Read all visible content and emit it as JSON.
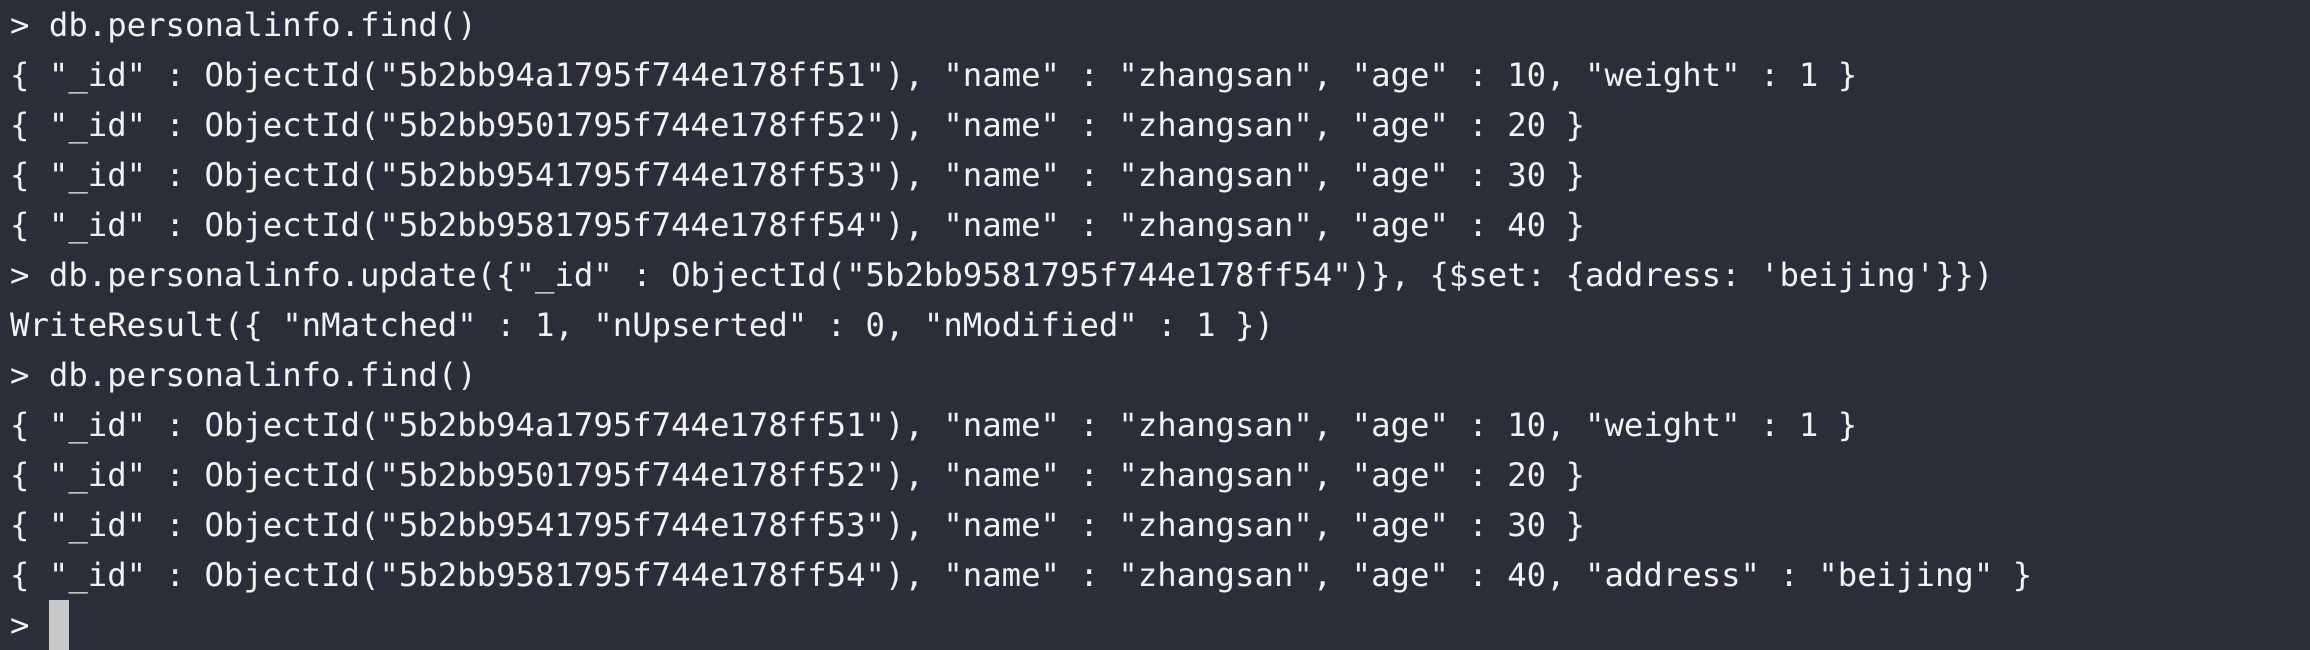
{
  "terminal": {
    "prompt": "> ",
    "lines": [
      {
        "prompt": "> ",
        "text": "db.personalinfo.find()"
      },
      {
        "prompt": "",
        "text": "{ \"_id\" : ObjectId(\"5b2bb94a1795f744e178ff51\"), \"name\" : \"zhangsan\", \"age\" : 10, \"weight\" : 1 }"
      },
      {
        "prompt": "",
        "text": "{ \"_id\" : ObjectId(\"5b2bb9501795f744e178ff52\"), \"name\" : \"zhangsan\", \"age\" : 20 }"
      },
      {
        "prompt": "",
        "text": "{ \"_id\" : ObjectId(\"5b2bb9541795f744e178ff53\"), \"name\" : \"zhangsan\", \"age\" : 30 }"
      },
      {
        "prompt": "",
        "text": "{ \"_id\" : ObjectId(\"5b2bb9581795f744e178ff54\"), \"name\" : \"zhangsan\", \"age\" : 40 }"
      },
      {
        "prompt": "> ",
        "text": "db.personalinfo.update({\"_id\" : ObjectId(\"5b2bb9581795f744e178ff54\")}, {$set: {address: 'beijing'}})"
      },
      {
        "prompt": "",
        "text": "WriteResult({ \"nMatched\" : 1, \"nUpserted\" : 0, \"nModified\" : 1 })"
      },
      {
        "prompt": "> ",
        "text": "db.personalinfo.find()"
      },
      {
        "prompt": "",
        "text": "{ \"_id\" : ObjectId(\"5b2bb94a1795f744e178ff51\"), \"name\" : \"zhangsan\", \"age\" : 10, \"weight\" : 1 }"
      },
      {
        "prompt": "",
        "text": "{ \"_id\" : ObjectId(\"5b2bb9501795f744e178ff52\"), \"name\" : \"zhangsan\", \"age\" : 20 }"
      },
      {
        "prompt": "",
        "text": "{ \"_id\" : ObjectId(\"5b2bb9541795f744e178ff53\"), \"name\" : \"zhangsan\", \"age\" : 30 }"
      },
      {
        "prompt": "",
        "text": "{ \"_id\" : ObjectId(\"5b2bb9581795f744e178ff54\"), \"name\" : \"zhangsan\", \"age\" : 40, \"address\" : \"beijing\" }"
      }
    ],
    "input_line": {
      "prompt": "> ",
      "text": ""
    }
  },
  "colors": {
    "background": "#2b2d38",
    "foreground": "#f2f2f2",
    "cursor": "#c8c8c8"
  }
}
